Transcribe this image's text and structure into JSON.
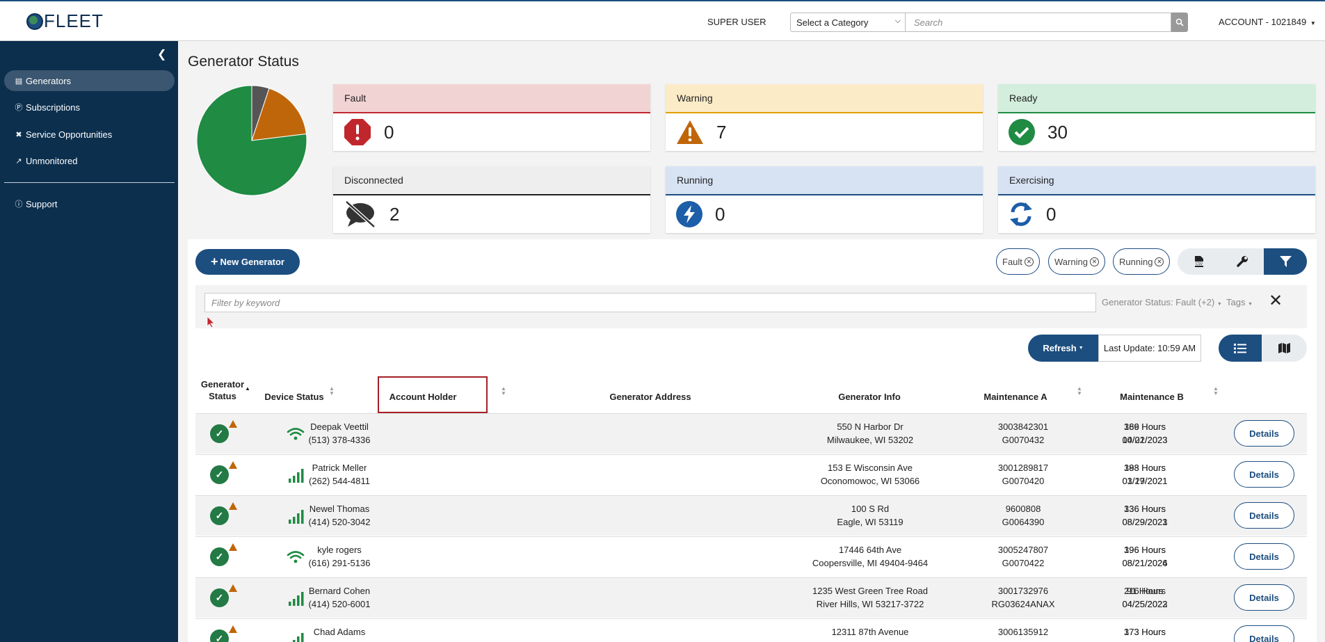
{
  "header": {
    "logo_text": "FLEET",
    "super_user": "SUPER USER",
    "category_select": "Select a Category",
    "search_placeholder": "Search",
    "account": "ACCOUNT - 1021849"
  },
  "sidebar": {
    "items": [
      {
        "label": "Generators",
        "icon": "table-icon",
        "active": true
      },
      {
        "label": "Subscriptions",
        "icon": "dollar-circle-icon",
        "active": false
      },
      {
        "label": "Service Opportunities",
        "icon": "tools-icon",
        "active": false
      },
      {
        "label": "Unmonitored",
        "icon": "chart-line-icon",
        "active": false
      },
      {
        "label": "Support",
        "icon": "question-circle-icon",
        "active": false
      }
    ]
  },
  "page_title": "Generator Status",
  "pie": {
    "slices": [
      {
        "label": "Ready",
        "value": 30,
        "color": "#1f8b43"
      },
      {
        "label": "Warning",
        "value": 7,
        "color": "#c0660a"
      },
      {
        "label": "Disconnected",
        "value": 2,
        "color": "#555555"
      }
    ]
  },
  "status_cards": [
    {
      "label": "Fault",
      "count": "0",
      "icon": "exclamation-octagon-icon",
      "head_bg": "#f2d3d3",
      "border": "#c0272d"
    },
    {
      "label": "Warning",
      "count": "7",
      "icon": "warning-triangle-icon",
      "head_bg": "#fcebc7",
      "border": "#e0a000"
    },
    {
      "label": "Ready",
      "count": "30",
      "icon": "check-circle-icon",
      "head_bg": "#d3eedc",
      "border": "#1f8b43"
    },
    {
      "label": "Disconnected",
      "count": "2",
      "icon": "comment-slash-icon",
      "head_bg": "#eeeeee",
      "border": "#222222"
    },
    {
      "label": "Running",
      "count": "0",
      "icon": "bolt-circle-icon",
      "head_bg": "#d7e3f3",
      "border": "#1c4e80"
    },
    {
      "label": "Exercising",
      "count": "0",
      "icon": "sync-icon",
      "head_bg": "#d7e3f3",
      "border": "#1c4e80"
    }
  ],
  "toolbar": {
    "new_generator": "New Generator",
    "chips": [
      "Fault",
      "Warning",
      "Running"
    ],
    "csv_label": "CSV"
  },
  "filters": {
    "keyword_placeholder": "Filter by keyword",
    "generator_status": "Generator Status: Fault (+2)",
    "tags": "Tags"
  },
  "refresh": {
    "label": "Refresh",
    "last_update": "Last Update: 10:59 AM"
  },
  "table": {
    "headers": {
      "generator_status_1": "Generator",
      "generator_status_2": "Status",
      "device_status": "Device Status",
      "account_holder": "Account Holder",
      "generator_address": "Generator Address",
      "generator_info": "Generator Info",
      "maintenance_a": "Maintenance A",
      "maintenance_b": "Maintenance B"
    },
    "details_label": "Details",
    "rows": [
      {
        "device": "wifi",
        "name": "Deepak Veettil",
        "phone": "(513) 378-4336",
        "addr1": "550 N Harbor Dr",
        "addr2": "Milwaukee, WI 53202",
        "info1": "3003842301",
        "info2": "G0070432",
        "ma1": "189 Hours",
        "ma2": "10/22/2023",
        "mb1": "366 Hours",
        "mb2": "04/01/2023"
      },
      {
        "device": "cell",
        "name": "Patrick Meller",
        "phone": "(262) 544-4811",
        "addr1": "153 E Wisconsin Ave",
        "addr2": "Oconomowoc, WI 53066",
        "info1": "3001289817",
        "info2": "G0070420",
        "ma1": "193 Hours",
        "ma2": "03/29/2021",
        "mb1": "388 Hours",
        "mb2": "01/17/2021"
      },
      {
        "device": "cell",
        "name": "Newel Thomas",
        "phone": "(414) 520-3042",
        "addr1": "100 S Rd",
        "addr2": "Eagle, WI 53119",
        "info1": "9600808",
        "info2": "G0064390",
        "ma1": "136 Hours",
        "ma2": "08/29/2021",
        "mb1": "336 Hours",
        "mb2": "08/29/2023"
      },
      {
        "device": "wifi",
        "name": "kyle rogers",
        "phone": "(616) 291-5136",
        "addr1": "17446 64th Ave",
        "addr2": "Coopersville, MI 49404-9464",
        "info1": "3005247807",
        "info2": "G0070422",
        "ma1": "196 Hours",
        "ma2": "08/21/2024",
        "mb1": "396 Hours",
        "mb2": "08/21/2026"
      },
      {
        "device": "cell",
        "name": "Bernard Cohen",
        "phone": "(414) 520-6001",
        "addr1": "1235 West Green Tree Road",
        "addr2": "River Hills, WI 53217-3722",
        "info1": "3001732976",
        "info2": "RG03624ANAX",
        "ma1": "91 Hours",
        "ma2": "04/25/2022",
        "mb1": "216 Hours",
        "mb2": "04/25/2023"
      },
      {
        "device": "cell",
        "name": "Chad Adams",
        "phone": "",
        "addr1": "12311 87th Avenue",
        "addr2": "",
        "info1": "3006135912",
        "info2": "",
        "ma1": "173 Hours",
        "ma2": "",
        "mb1": "373 Hours",
        "mb2": ""
      }
    ]
  }
}
